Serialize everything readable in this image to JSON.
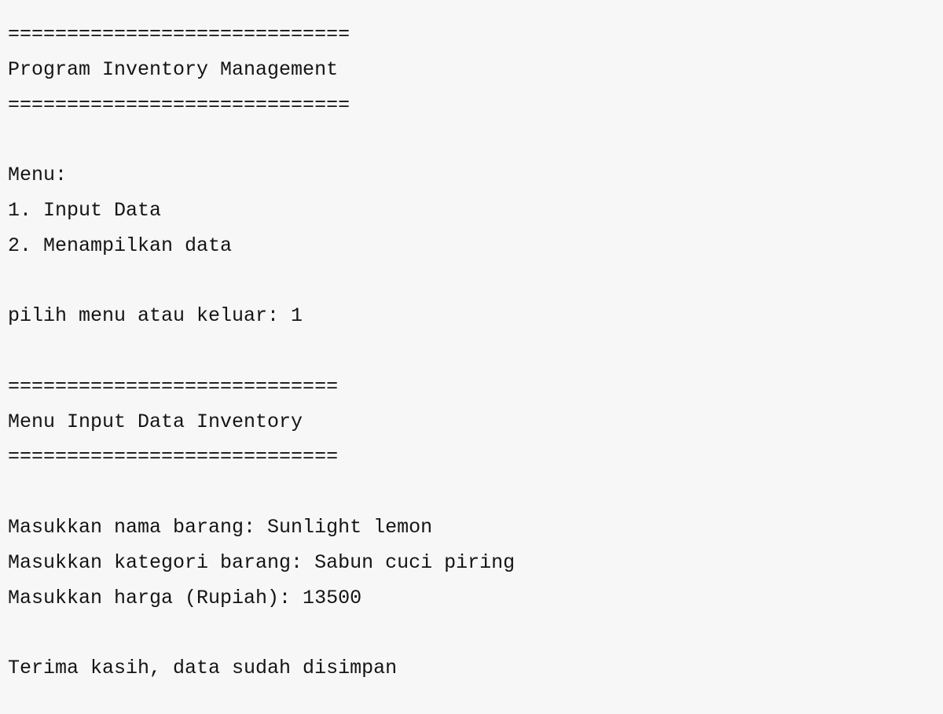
{
  "console": {
    "header_rule_top": "=============================",
    "title": "Program Inventory Management",
    "header_rule_bottom": "=============================",
    "menu_heading": "Menu:",
    "menu_option_1": "1. Input Data",
    "menu_option_2": "2. Menampilkan data",
    "prompt_menu": "pilih menu atau keluar: 1",
    "section_rule_top": "============================",
    "section_title": "Menu Input Data Inventory",
    "section_rule_bottom": "============================",
    "input_name": "Masukkan nama barang: Sunlight lemon",
    "input_category": "Masukkan kategori barang: Sabun cuci piring",
    "input_price": "Masukkan harga (Rupiah): 13500",
    "confirmation": "Terima kasih, data sudah disimpan"
  }
}
